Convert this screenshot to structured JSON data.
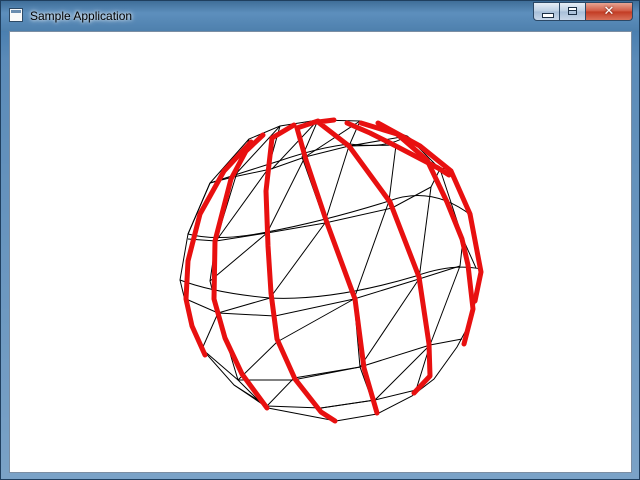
{
  "window": {
    "title": "Sample Application",
    "app_icon": "window-app-icon",
    "caption_buttons": [
      {
        "name": "minimize-button",
        "icon": "minimize-icon"
      },
      {
        "name": "maximize-button",
        "icon": "maximize-icon"
      },
      {
        "name": "close-button",
        "icon": "close-icon",
        "glyph": "✕"
      }
    ]
  },
  "scene": {
    "object": "wireframe-sphere",
    "background_color": "#ffffff",
    "wire_color": "#000000",
    "highlight_color": "#e81010"
  }
}
